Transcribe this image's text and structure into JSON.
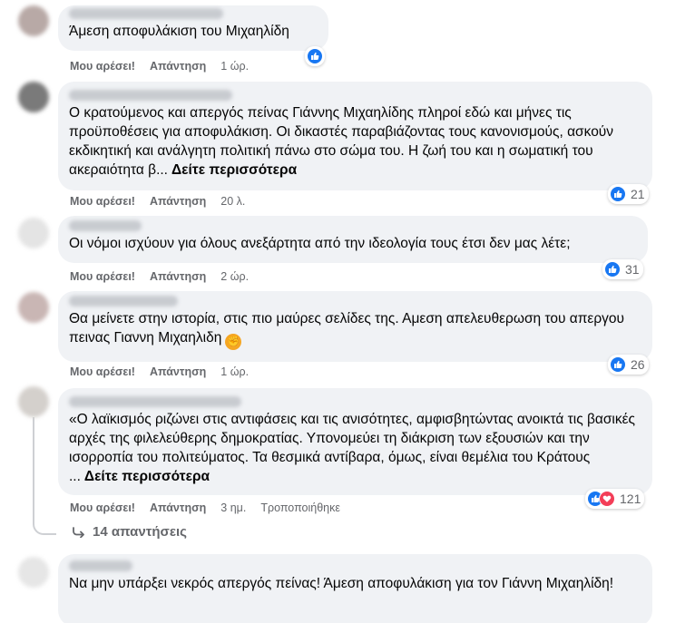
{
  "labels": {
    "like": "Μου αρέσει!",
    "reply": "Απάντηση",
    "see_more": "Δείτε περισσότερα",
    "edited": "Τροποποιήθηκε"
  },
  "colors": {
    "like_blue": "#1877f2",
    "love_red": "#f33e58",
    "bubble_bg": "#f0f2f5",
    "meta_gray": "#65676b"
  },
  "comments": [
    {
      "text": "Άμεση αποφυλάκιση του Μιχαηλίδη",
      "time": "1 ώρ.",
      "reactions": {
        "types": [
          "like"
        ],
        "count": ""
      }
    },
    {
      "text": "Ο κρατούμενος και απεργός πείνας Γιάννης Μιχαηλίδης πληροί εδώ και μήνες τις προϋποθέσεις για αποφυλάκιση. Οι δικαστές παραβιάζοντας τους κανονισμούς, ασκούν εκδικητική και ανάλγητη πολιτική πάνω στο σώμα του. Η ζωή του και η σωματική του ακεραιότητα β...",
      "time": "20 λ.",
      "reactions": {
        "types": [
          "like"
        ],
        "count": "21"
      }
    },
    {
      "text": "Οι νόμοι ισχύουν για όλους ανεξάρτητα από την ιδεολογία τους έτσι δεν μας λέτε;",
      "time": "2 ώρ.",
      "reactions": {
        "types": [
          "like"
        ],
        "count": "31"
      }
    },
    {
      "text": "Θα μείνετε στην ιστορία, στις πιο μαύρες σελίδες της. Αμεση απελευθερωση του απεργου πεινας Γιαννη Μιχαηλιδη",
      "emoji": "fist-emoji",
      "time": "1 ώρ.",
      "reactions": {
        "types": [
          "like"
        ],
        "count": "26"
      }
    },
    {
      "text": "«Ο λαϊκισμός ριζώνει στις αντιφάσεις και τις ανισότητες, αμφισβητώντας ανοικτά τις βασικές αρχές της φιλελεύθερης δημοκρατίας. Υπονομεύει τη διάκριση των εξουσιών και την ισορροπία του πολιτεύματος. Τα θεσμικά αντίβαρα, όμως, είναι θεμέλια του Κράτους ...",
      "time": "3 ημ.",
      "edited": true,
      "reactions": {
        "types": [
          "like",
          "love"
        ],
        "count": "121"
      },
      "replies_label": "14 απαντήσεις"
    },
    {
      "text": "Να μην υπάρξει νεκρός απεργός πείνας! Άμεση αποφυλάκιση για τον Γιάννη Μιχαηλίδη!"
    }
  ]
}
